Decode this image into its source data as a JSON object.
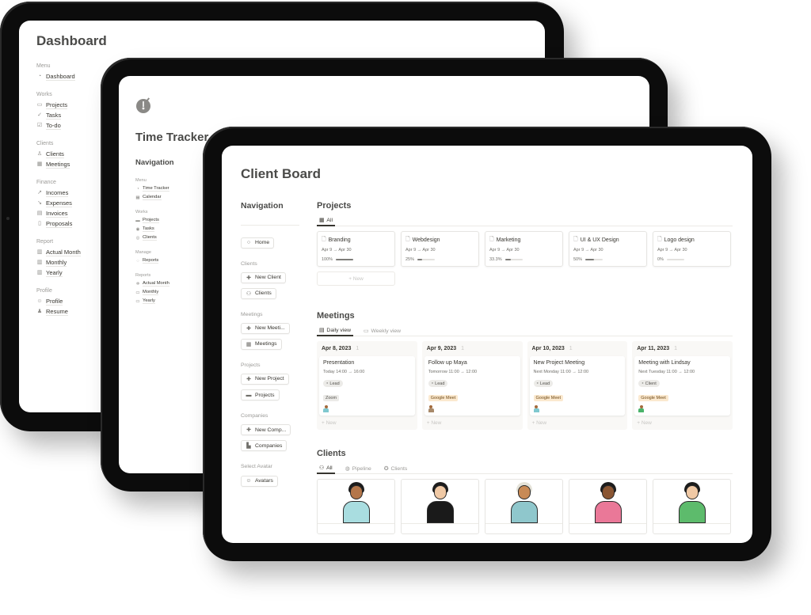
{
  "back_screen": {
    "title": "Dashboard",
    "sections": [
      {
        "label": "Menu",
        "items": [
          {
            "icon": "dashboard-icon",
            "glyph": "◔",
            "label": "Dashboard"
          }
        ]
      },
      {
        "label": "Works",
        "items": [
          {
            "icon": "folder-icon",
            "glyph": "▭",
            "label": "Projects"
          },
          {
            "icon": "check-circle-icon",
            "glyph": "✓",
            "label": "Tasks"
          },
          {
            "icon": "checkbox-icon",
            "glyph": "☑",
            "label": "To-do"
          }
        ]
      },
      {
        "label": "Clients",
        "items": [
          {
            "icon": "user-icon",
            "glyph": "♙",
            "label": "Clients"
          },
          {
            "icon": "calendar-icon",
            "glyph": "▦",
            "label": "Meetings"
          }
        ]
      },
      {
        "label": "Finance",
        "items": [
          {
            "icon": "chart-up-icon",
            "glyph": "↗",
            "label": "Incomes"
          },
          {
            "icon": "chart-down-icon",
            "glyph": "↘",
            "label": "Expenses"
          },
          {
            "icon": "invoice-icon",
            "glyph": "▤",
            "label": "Invoices"
          },
          {
            "icon": "document-icon",
            "glyph": "▯",
            "label": "Proposals"
          }
        ]
      },
      {
        "label": "Report",
        "items": [
          {
            "icon": "bar-chart-icon",
            "glyph": "▥",
            "label": "Actual Month"
          },
          {
            "icon": "bar-chart-icon",
            "glyph": "▥",
            "label": "Monthly"
          },
          {
            "icon": "bar-chart-icon",
            "glyph": "▥",
            "label": "Yearly"
          }
        ]
      },
      {
        "label": "Profile",
        "items": [
          {
            "icon": "profile-icon",
            "glyph": "☺",
            "label": "Profile"
          },
          {
            "icon": "person-avatar-icon",
            "glyph": "♟",
            "label": "Resume"
          }
        ]
      }
    ]
  },
  "middle_screen": {
    "title": "Time Tracker",
    "nav_title": "Navigation",
    "sections": [
      {
        "label": "Menu",
        "items": [
          {
            "icon": "timer-icon",
            "glyph": "◔",
            "label": "Time Tracker"
          },
          {
            "icon": "calendar-icon",
            "glyph": "▦",
            "label": "Calendar"
          }
        ]
      },
      {
        "label": "Works",
        "items": [
          {
            "icon": "folder-icon",
            "glyph": "▬",
            "label": "Projects"
          },
          {
            "icon": "check-circle-icon",
            "glyph": "◉",
            "label": "Tasks"
          },
          {
            "icon": "user-circle-icon",
            "glyph": "◎",
            "label": "Clients"
          }
        ]
      },
      {
        "label": "Manage",
        "items": [
          {
            "icon": "reports-icon",
            "glyph": "◌",
            "label": "Reports"
          }
        ]
      },
      {
        "label": "Reports",
        "items": [
          {
            "icon": "gear-icon",
            "glyph": "✲",
            "label": "Actual Month"
          },
          {
            "icon": "calendar-icon",
            "glyph": "▭",
            "label": "Monthly"
          },
          {
            "icon": "calendar-icon",
            "glyph": "▭",
            "label": "Yearly"
          }
        ]
      }
    ]
  },
  "front_screen": {
    "title": "Client Board",
    "nav": {
      "title": "Navigation",
      "home": {
        "icon": "home-icon",
        "glyph": "○",
        "label": "Home"
      },
      "sections": [
        {
          "label": "Clients",
          "buttons": [
            {
              "icon": "plus-circle-icon",
              "glyph": "✚",
              "label": "New Client"
            },
            {
              "icon": "people-icon",
              "glyph": "⚇",
              "label": "Clients"
            }
          ]
        },
        {
          "label": "Meetings",
          "buttons": [
            {
              "icon": "plus-circle-icon",
              "glyph": "✚",
              "label": "New Meeti..."
            },
            {
              "icon": "calendar-icon",
              "glyph": "▦",
              "label": "Meetings"
            }
          ]
        },
        {
          "label": "Projects",
          "buttons": [
            {
              "icon": "plus-circle-icon",
              "glyph": "✚",
              "label": "New Project"
            },
            {
              "icon": "folder-icon",
              "glyph": "▬",
              "label": "Projects"
            }
          ]
        },
        {
          "label": "Companies",
          "buttons": [
            {
              "icon": "plus-circle-icon",
              "glyph": "✚",
              "label": "New Comp..."
            },
            {
              "icon": "building-icon",
              "glyph": "▙",
              "label": "Companies"
            }
          ]
        },
        {
          "label": "Select Avatar",
          "buttons": [
            {
              "icon": "avatar-icon",
              "glyph": "☺",
              "label": "Avatars"
            }
          ]
        }
      ]
    },
    "projects": {
      "title": "Projects",
      "tabs": [
        {
          "icon": "gallery-icon",
          "glyph": "▦",
          "label": "All",
          "active": true
        }
      ],
      "cards": [
        {
          "name": "Branding",
          "dates": "Apr 9 → Apr 30",
          "progress_label": "100%",
          "progress": 1.0
        },
        {
          "name": "Webdesign",
          "dates": "Apr 9 → Apr 30",
          "progress_label": "25%",
          "progress": 0.25
        },
        {
          "name": "Marketing",
          "dates": "Apr 9 → Apr 30",
          "progress_label": "33.3%",
          "progress": 0.333
        },
        {
          "name": "UI & UX Design",
          "dates": "Apr 9 → Apr 30",
          "progress_label": "50%",
          "progress": 0.5
        },
        {
          "name": "Logo design",
          "dates": "Apr 9 → Apr 30",
          "progress_label": "0%",
          "progress": 0.0
        }
      ],
      "new_label": "+ New"
    },
    "meetings": {
      "title": "Meetings",
      "tabs": [
        {
          "icon": "board-icon",
          "glyph": "▤",
          "label": "Daily view",
          "active": true
        },
        {
          "icon": "calendar-icon",
          "glyph": "▭",
          "label": "Weekly view",
          "active": false
        }
      ],
      "columns": [
        {
          "date": "Apr 8, 2023",
          "count": "1",
          "card": {
            "title": "Presentation",
            "time": "Today 14:00 → 16:00",
            "status": "Lead",
            "platform": "Zoom",
            "platform_kind": "zoom",
            "avatar_color": "#7fc8cf"
          }
        },
        {
          "date": "Apr 9, 2023",
          "count": "1",
          "card": {
            "title": "Follow up Maya",
            "time": "Tomorrow 11:00 → 12:00",
            "status": "Lead",
            "platform": "Google Meet",
            "platform_kind": "gmeet",
            "avatar_color": "#a88a6a"
          }
        },
        {
          "date": "Apr 10, 2023",
          "count": "1",
          "card": {
            "title": "New Project Meeting",
            "time": "Next Monday 11:00 → 12:00",
            "status": "Lead",
            "platform": "Google Meet",
            "platform_kind": "gmeet",
            "avatar_color": "#7fc8cf"
          }
        },
        {
          "date": "Apr 11, 2023",
          "count": "1",
          "card": {
            "title": "Meeting with Lindsay",
            "time": "Next Tuesday 11:00 → 12:00",
            "status": "Client",
            "platform": "Google Meet",
            "platform_kind": "gmeet",
            "avatar_color": "#4bb36a"
          }
        }
      ],
      "new_label": "+ New"
    },
    "clients": {
      "title": "Clients",
      "tabs": [
        {
          "icon": "people-icon",
          "glyph": "⚇",
          "label": "All",
          "active": true
        },
        {
          "icon": "pipeline-icon",
          "glyph": "◍",
          "label": "Pipeline",
          "active": false
        },
        {
          "icon": "check-badge-icon",
          "glyph": "✪",
          "label": "Clients",
          "active": false
        }
      ],
      "cards": [
        {
          "shirt": "#a9dde0",
          "hair": "#1c1c1c",
          "skin": "#b4764a"
        },
        {
          "shirt": "#1a1a1a",
          "hair": "#1c1c1c",
          "skin": "#f0c9a5"
        },
        {
          "shirt": "#8fc7cc",
          "hair": "#e4e2d8",
          "skin": "#c88a55"
        },
        {
          "shirt": "#ea7898",
          "hair": "#1c1c1c",
          "skin": "#8a5633"
        },
        {
          "shirt": "#5dbb6c",
          "hair": "#1c1c1c",
          "skin": "#f0c9a5"
        }
      ]
    }
  }
}
